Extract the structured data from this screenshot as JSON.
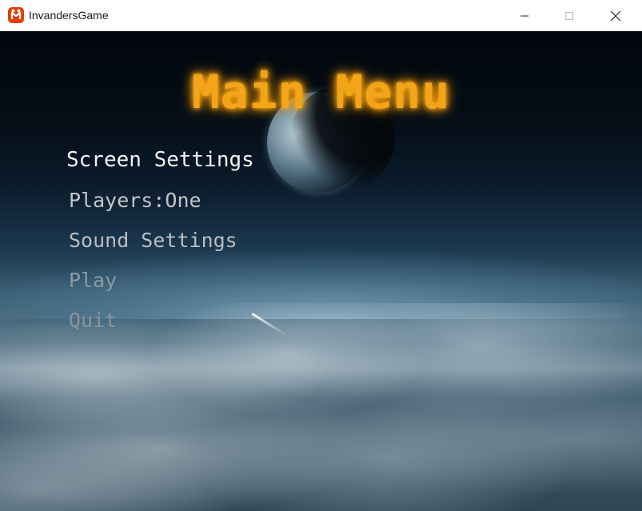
{
  "window": {
    "title": "InvandersGame",
    "icon": "monogame-logo-icon",
    "controls": [
      "minimize-icon",
      "maximize-icon",
      "close-icon"
    ]
  },
  "menu": {
    "title": "Main Menu",
    "title_color": "#f3a51a",
    "items": [
      {
        "label": "Screen Settings",
        "selected": true
      },
      {
        "label": "Players:One",
        "selected": false
      },
      {
        "label": "Sound Settings",
        "selected": false
      },
      {
        "label": "Play",
        "selected": false
      },
      {
        "label": "Quit",
        "selected": false
      }
    ]
  }
}
